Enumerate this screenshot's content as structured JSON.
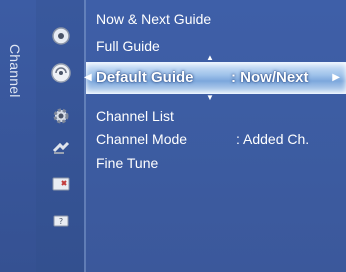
{
  "sidebar": {
    "title": "Channel",
    "icons": [
      "picture-icon",
      "channel-icon",
      "setup-icon",
      "input-icon",
      "application-icon",
      "support-icon"
    ]
  },
  "menu": {
    "items": [
      {
        "label": "Now & Next Guide"
      },
      {
        "label": "Full Guide"
      },
      {
        "label": "Default Guide",
        "value": ": Now/Next",
        "selected": true
      },
      {
        "label": "Channel List"
      },
      {
        "label": "Channel Mode",
        "value": ":  Added Ch."
      },
      {
        "label": "Fine Tune"
      }
    ]
  },
  "colors": {
    "background": "#3d5da3",
    "highlight": "#9fc2ea",
    "text": "#ffffff"
  }
}
